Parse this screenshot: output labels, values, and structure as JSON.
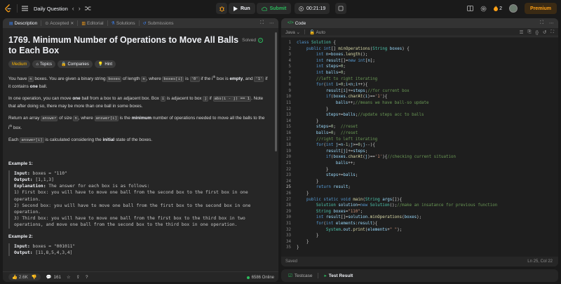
{
  "nav": {
    "title": "Daily Question",
    "run_label": "Run",
    "submit_label": "Submit",
    "timer": "00:21:19",
    "streak_count": "2",
    "premium_label": "Premium"
  },
  "left_tabs": [
    {
      "label": "Description"
    },
    {
      "label": "Accepted"
    },
    {
      "label": "Editorial"
    },
    {
      "label": "Solutions"
    },
    {
      "label": "Submissions"
    }
  ],
  "problem": {
    "title": "1769. Minimum Number of Operations to Move All Balls to Each Box",
    "status": "Solved",
    "difficulty": "Medium",
    "tag_topics": "Topics",
    "tag_companies": "Companies",
    "tag_hint": "Hint",
    "p1_a": "You have ",
    "p1_n": "n",
    "p1_b": " boxes. You are given a binary string ",
    "p1_boxes": "boxes",
    "p1_c": " of length ",
    "p1_n2": "n",
    "p1_d": ", where ",
    "p1_boxesi": "boxes[i]",
    "p1_e": " is ",
    "p1_zero": "'0'",
    "p1_f": " if the i",
    "p1_sup": "th",
    "p1_g": " box is ",
    "p1_empty": "empty",
    "p1_h": ", and ",
    "p1_one": "'1'",
    "p1_i": " if it contains ",
    "p1_oneword": "one",
    "p1_j": " ball.",
    "p2_a": "In one operation, you can move ",
    "p2_one": "one",
    "p2_b": " ball from a box to an adjacent box. Box ",
    "p2_i": "i",
    "p2_c": " is adjacent to box ",
    "p2_j": "j",
    "p2_d": " if ",
    "p2_abs": "abs(i - j) == 1",
    "p2_e": ". Note that after doing so, there may be more than one ball in some boxes.",
    "p3_a": "Return an array ",
    "p3_answer": "answer",
    "p3_b": " of size ",
    "p3_n": "n",
    "p3_c": ", where ",
    "p3_answeri": "answer[i]",
    "p3_d": " is the ",
    "p3_min": "minimum",
    "p3_e": " number of operations needed to move all the balls to the i",
    "p3_sup": "th",
    "p3_f": " box.",
    "p4_a": "Each ",
    "p4_answeri": "answer[i]",
    "p4_b": " is calculated considering the ",
    "p4_initial": "initial",
    "p4_c": " state of the boxes.",
    "ex1_title": "Example 1:",
    "ex1_input_lbl": "Input:",
    "ex1_input": " boxes = \"110\"",
    "ex1_output_lbl": "Output:",
    "ex1_output": " [1,1,3]",
    "ex1_expl_lbl": "Explanation:",
    "ex1_expl": " The answer for each box is as follows:",
    "ex1_l1": "1) First box: you will have to move one ball from the second box to the first box in one",
    "ex1_l1b": "operation.",
    "ex1_l2": "2) Second box: you will have to move one ball from the first box to the second box in one",
    "ex1_l2b": "operation.",
    "ex1_l3": "3) Third box: you will have to move one ball from the first box to the third box in two",
    "ex1_l3b": "operations, and move one ball from the second box to the third box in one operation.",
    "ex2_title": "Example 2:",
    "ex2_input_lbl": "Input:",
    "ex2_input": " boxes = \"001011\"",
    "ex2_output_lbl": "Output:",
    "ex2_output": " [11,8,5,4,3,4]"
  },
  "desc_footer": {
    "likes": "2.6K",
    "comments": "161",
    "online": "6586 Online"
  },
  "code_panel": {
    "title": "Code",
    "language": "Java",
    "mode": "Auto",
    "status_left": "Saved",
    "status_right": "Ln 25, Col 22"
  },
  "code_lines": [
    "class Solution {",
    "    public int[] minOperations(String boxes) {",
    "        int n=boxes.length();",
    "        int result[]=new int[n];",
    "        int steps=0;",
    "        int balls=0;",
    "        //left to right iterating",
    "        for(int i=0;i<n;i++){",
    "            result[i]+=steps;//for current box",
    "            if(boxes.charAt(i)=='1'){",
    "                balls++;//means we have ball-so update",
    "            }",
    "            steps+=balls;//update steps acc to balls",
    "        }",
    "        steps=0;  //reset",
    "        balls=0;  //reset",
    "        //right to left iterating",
    "        for(int j=n-1;j>=0;j--){",
    "            result[j]+=steps;",
    "            if(boxes.charAt(j)=='1'){//checking current situation",
    "                balls++;",
    "            }",
    "            steps+=balls;",
    "        }",
    "        return result;",
    "    }",
    "    public static void main(String args[]){",
    "        Solution solution=new Solution();//make an insatance for previous function",
    "        String boxes=\"110\";",
    "        int result[]=solution.minOperations(boxes);",
    "        for(int elements:result){",
    "            System.out.print(elements+\" \");",
    "        }",
    "    }",
    "}"
  ],
  "bottom_tabs": [
    {
      "label": "Testcase"
    },
    {
      "label": "Test Result"
    }
  ]
}
